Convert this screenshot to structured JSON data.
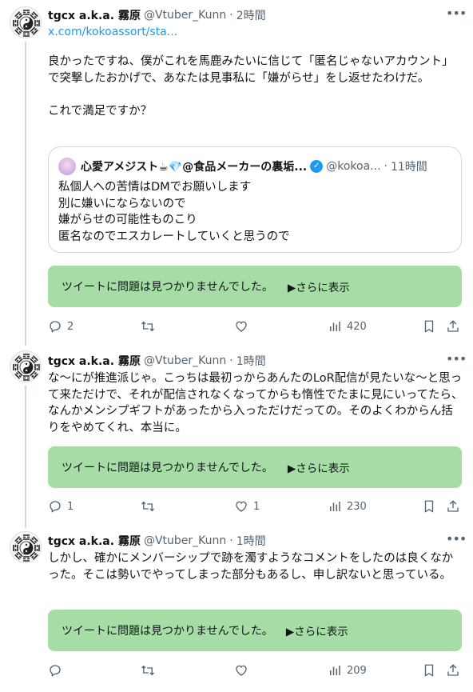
{
  "tweets": [
    {
      "name": "tgcx a.k.a. 霧原",
      "handle": "@Vtuber_Kunn",
      "time": "2時間",
      "link": "x.com/kokoassort/sta...",
      "text": "良かったですね、僕がこれを馬鹿みたいに信じて「匿名じゃないアカウント」で突撃したおかげで、あなたは見事私に「嫌がらせ」をし返せたわけだ。\n\nこれで満足ですか？",
      "quote": {
        "name": "心愛アメジスト☕💎@食品メーカーの裏垢...",
        "handle": "@kokoa...",
        "time": "11時間",
        "text": "私個人への苦情はDMでお願いします\n別に嫌いにならないので\n嫌がらせの可能性ものこり\n匿名なのでエスカレートしていくと思うので"
      },
      "notice": "ツイートに問題は見つかりませんでした。",
      "show_more": "▶さらに表示",
      "replies": "2",
      "likes": "",
      "views": "420"
    },
    {
      "name": "tgcx a.k.a. 霧原",
      "handle": "@Vtuber_Kunn",
      "time": "1時間",
      "text": "な～にが推進派じゃ。こっちは最初っからあんたのLoR配信が見たいな～と思って来ただけで、それが配信されなくなってからも惰性でたまに見にいってたら、なんかメンシプギフトがあったから入っただけだっての。そのよくわからん括りをやめてくれ、本当に。",
      "notice": "ツイートに問題は見つかりませんでした。",
      "show_more": "▶さらに表示",
      "replies": "1",
      "likes": "1",
      "views": "230"
    },
    {
      "name": "tgcx a.k.a. 霧原",
      "handle": "@Vtuber_Kunn",
      "time": "1時間",
      "text": "しかし、確かにメンバーシップで跡を濁すようなコメントをしたのは良くなかった。そこは勢いでやってしまった部分もあるし、申し訳ないと思っている。",
      "notice": "ツイートに問題は見つかりませんでした。",
      "show_more": "▶さらに表示",
      "replies": "",
      "likes": "",
      "views": "209"
    }
  ],
  "icons": {
    "avatar": "yin-yang-bagua-icon",
    "reply": "reply-icon",
    "retweet": "retweet-icon",
    "like": "heart-icon",
    "views": "views-bar-icon",
    "bookmark": "bookmark-icon",
    "share": "share-icon",
    "more": "more-icon",
    "verified": "verified-icon"
  },
  "colors": {
    "notice_bg": "#a6dda6",
    "link": "#1d9bf0",
    "muted": "#536471"
  }
}
